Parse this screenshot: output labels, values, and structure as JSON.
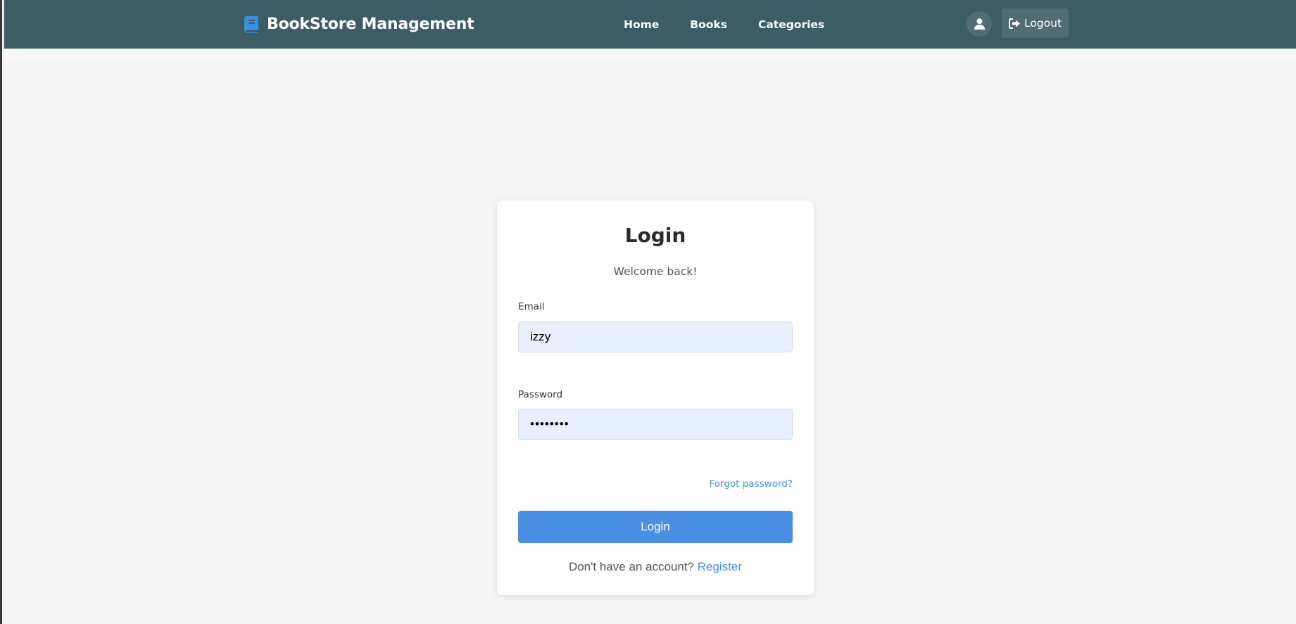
{
  "header": {
    "brand_title": "BookStore Management",
    "brand_icon": "book-icon",
    "nav_items": [
      {
        "label": "Home"
      },
      {
        "label": "Books"
      },
      {
        "label": "Categories"
      }
    ],
    "user_icon": "user-icon",
    "logout_icon": "sign-out-icon",
    "logout_label": "Logout"
  },
  "login": {
    "title": "Login",
    "subtitle": "Welcome back!",
    "email_label": "Email",
    "email_value": "izzy",
    "password_label": "Password",
    "password_value": "12345678",
    "forgot_label": "Forgot password?",
    "submit_label": "Login",
    "register_prompt": "Don't have an account?",
    "register_label": "Register"
  },
  "colors": {
    "navbar": "#3b5d63",
    "accent": "#4a90e2",
    "brand_icon": "#3a8fd9",
    "background": "#f4f4f4",
    "input_fill": "#e8f0fe"
  }
}
